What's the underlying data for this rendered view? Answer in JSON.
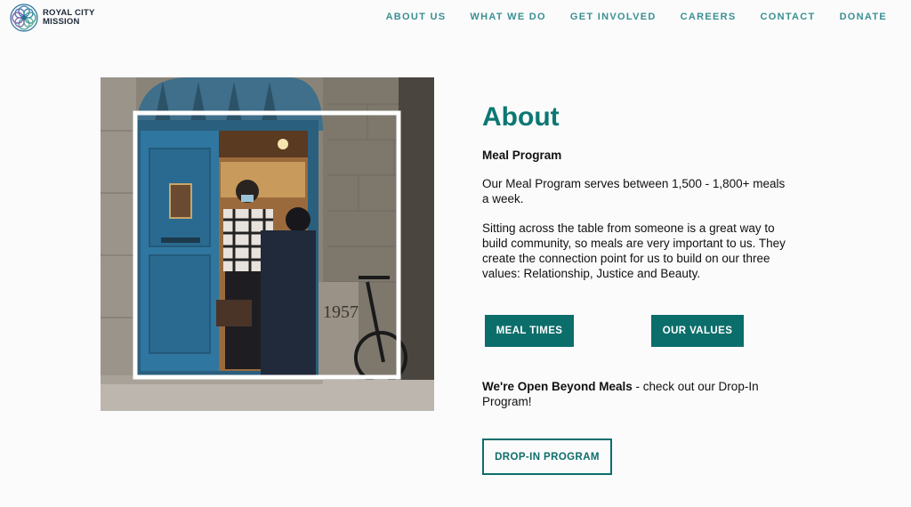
{
  "brand": {
    "line1": "ROYAL CITY",
    "line2": "MISSION"
  },
  "nav": {
    "about": "ABOUT US",
    "what_we_do": "WHAT WE DO",
    "get_involved": "GET INVOLVED",
    "careers": "CAREERS",
    "contact": "CONTACT",
    "donate": "DONATE"
  },
  "photo": {
    "year_inscription": "1957"
  },
  "main": {
    "title": "About",
    "subtitle": "Meal Program",
    "para1": "Our Meal Program serves between 1,500 - 1,800+ meals a week.",
    "para2": "Sitting across the table from someone is a great way to build community, so meals are very important to us. They create the connection point for us to build on our three values: Relationship, Justice and Beauty.",
    "btn_meal_times": "MEAL TIMES",
    "btn_our_values": "OUR VALUES",
    "beyond_bold": "We're Open Beyond Meals",
    "beyond_rest": " - check out our Drop-In Program!",
    "btn_dropin": "DROP-IN PROGRAM"
  },
  "colors": {
    "accent": "#0c7773",
    "nav": "#3a8f93",
    "button": "#0c6e6a",
    "background": "#fbfbfb"
  }
}
